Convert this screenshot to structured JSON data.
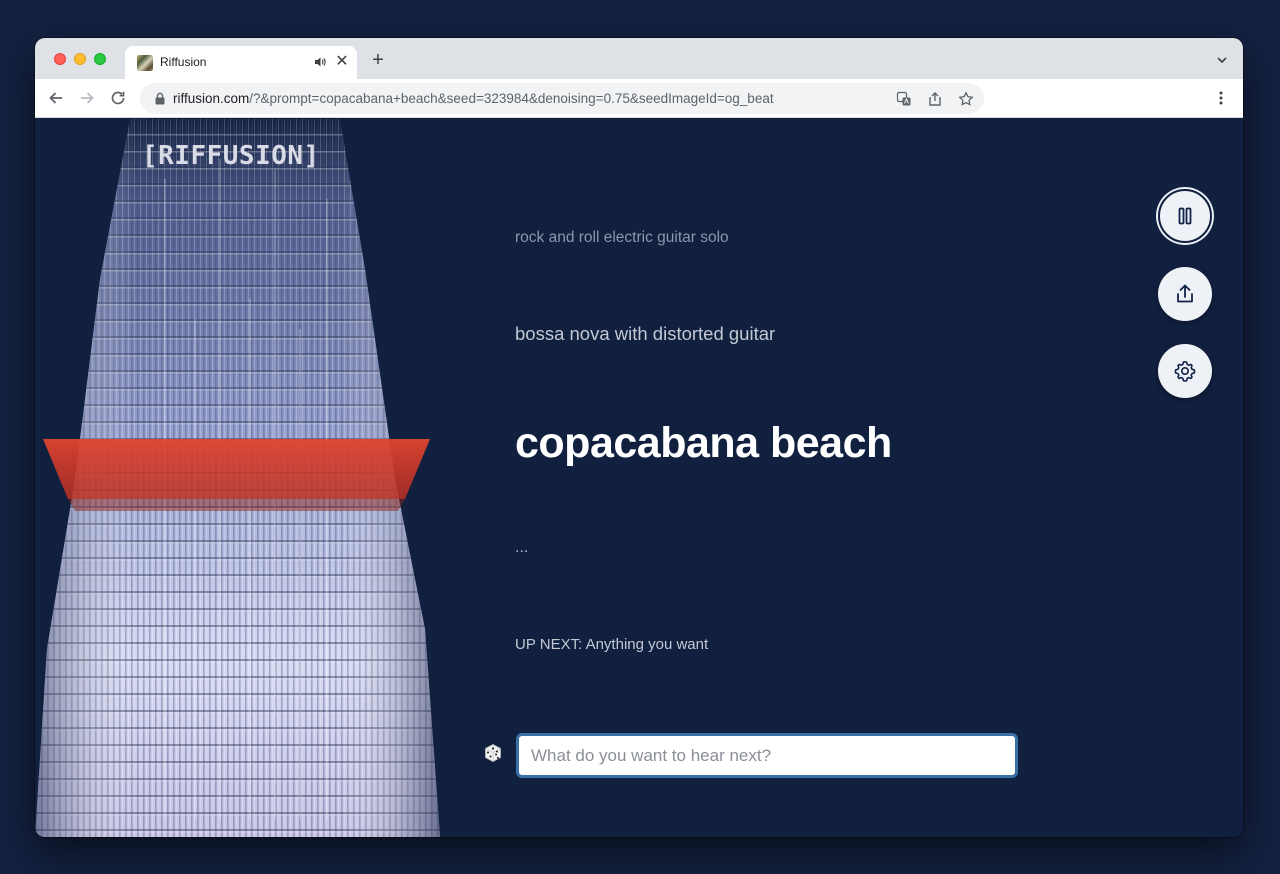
{
  "browser": {
    "tab_title": "Riffusion",
    "url_host": "riffusion.com",
    "url_path": "/?&prompt=copacabana+beach&seed=323984&denoising=0.75&seedImageId=og_beat"
  },
  "app": {
    "logo": "[RIFFUSION]",
    "prompts": {
      "previous_2": "rock and roll electric guitar solo",
      "previous_1": "bossa nova with distorted guitar",
      "current": "copacabana beach",
      "pending": "..."
    },
    "up_next": "UP NEXT: Anything you want",
    "input_placeholder": "What do you want to hear next?"
  },
  "icons": {
    "pause": "pause-icon",
    "share": "share-icon",
    "settings": "gear-icon",
    "dice": "dice-icon"
  },
  "colors": {
    "page_background": "#11203f",
    "playhead": "#d8402f",
    "input_border": "#3a6fa8"
  }
}
